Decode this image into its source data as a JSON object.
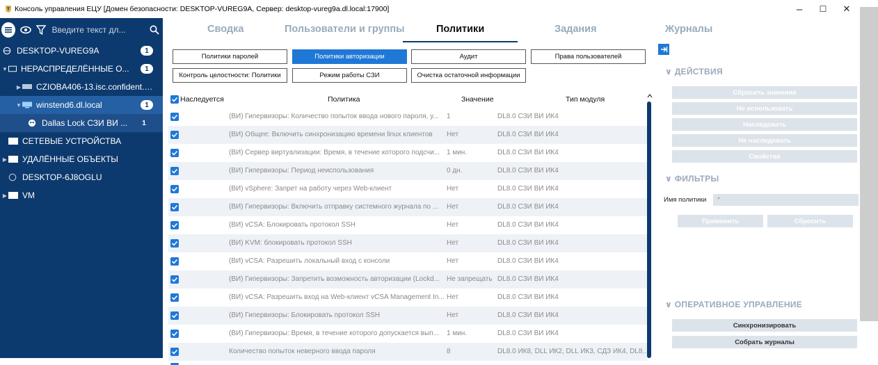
{
  "window": {
    "title": "Консоль управления ЕЦУ [Домен безопасности: DESKTOP-VUREG9A, Сервер: desktop-vureg9a.dl.local:17900]",
    "minimize": "–",
    "maximize": "☐",
    "close": "✕"
  },
  "search": {
    "placeholder": "Введите текст дл..."
  },
  "tree": [
    {
      "label": "DESKTOP-VUREG9A",
      "badge": "1"
    },
    {
      "label": "НЕРАСПРЕДЕЛЁННЫЕ О...",
      "badge": "1"
    },
    {
      "label": "CZIOBA406-13.isc.confident.s..."
    },
    {
      "label": "winstend6.dl.local",
      "badge": "1"
    },
    {
      "label": "Dallas Lock СЗИ ВИ ...",
      "badge": "1"
    },
    {
      "label": "СЕТЕВЫЕ УСТРОЙСТВА"
    },
    {
      "label": "УДАЛЁННЫЕ ОБЪЕКТЫ"
    },
    {
      "label": "DESKTOP-6J8OGLU"
    },
    {
      "label": "VM"
    }
  ],
  "tabs": [
    "Сводка",
    "Пользователи и группы",
    "Политики",
    "Задания",
    "Журналы"
  ],
  "policy_buttons": [
    "Политики паролей",
    "Политики авторизации",
    "Аудит",
    "Права пользователей",
    "Контроль целостности: Политики",
    "Режим работы СЗИ",
    "Очистка остаточной информации"
  ],
  "table": {
    "headers": {
      "inherited": "Наследуется",
      "policy": "Политика",
      "value": "Значение",
      "module": "Тип модуля"
    },
    "rows": [
      {
        "policy": "(ВИ) Гипервизоры: Количество попыток ввода нового пароля, у...",
        "value": "1",
        "module": "DL8.0 СЗИ ВИ ИК4"
      },
      {
        "policy": "(ВИ) Общее: Включить синхронизацию времени linux клиентов",
        "value": "Нет",
        "module": "DL8.0 СЗИ ВИ ИК4"
      },
      {
        "policy": "(ВИ) Сервер виртуализации: Время, в течение которого подсчи...",
        "value": "1 мин.",
        "module": "DL8.0 СЗИ ВИ ИК4"
      },
      {
        "policy": "(ВИ) Гипервизоры: Период неиспользования",
        "value": "0 дн.",
        "module": "DL8.0 СЗИ ВИ ИК4"
      },
      {
        "policy": "(ВИ) vSphere: Запрет на работу через Web-клиент",
        "value": "Нет",
        "module": "DL8.0 СЗИ ВИ ИК4"
      },
      {
        "policy": "(ВИ) Гипервизоры: Включить отправку системного журнала по ...",
        "value": "Нет",
        "module": "DL8.0 СЗИ ВИ ИК4"
      },
      {
        "policy": "(ВИ) vCSA: Блокировать протокол SSH",
        "value": "Нет",
        "module": "DL8.0 СЗИ ВИ ИК4"
      },
      {
        "policy": "(ВИ) KVM: блокировать протокол SSH",
        "value": "Нет",
        "module": "DL8.0 СЗИ ВИ ИК4"
      },
      {
        "policy": "(ВИ) vCSA: Разрешить локальный вход с консоли",
        "value": "Нет",
        "module": "DL8.0 СЗИ ВИ ИК4"
      },
      {
        "policy": "(ВИ) Гипервизоры: Запретить возможность авторизации (Lockd...",
        "value": "Не запрещать",
        "module": "DL8.0 СЗИ ВИ ИК4"
      },
      {
        "policy": "(ВИ) vCSA: Разрешить вход на Web-клиент vCSA Management In...",
        "value": "Нет",
        "module": "DL8.0 СЗИ ВИ ИК4"
      },
      {
        "policy": "(ВИ) Гипервизоры: Блокировать протокол SSH",
        "value": "Нет",
        "module": "DL8.0 СЗИ ВИ ИК4"
      },
      {
        "policy": "(ВИ) Гипервизоры: Время, в течение которого допускается вып...",
        "value": "1 мин.",
        "module": "DL8.0 СЗИ ВИ ИК4"
      },
      {
        "policy": "Количество попыток неверного ввода пароля",
        "value": "8",
        "module": "DL8.0 ИК8, DLL ИК2, DLL ИК3, СДЗ ИК4, DL8..."
      }
    ]
  },
  "actions": {
    "title": "ДЕЙСТВИЯ",
    "buttons": [
      "Сбросить значение",
      "Не использовать",
      "Наследовать",
      "Не наследовать",
      "Свойства"
    ]
  },
  "filters": {
    "title": "ФИЛЬТРЫ",
    "name_label": "Имя политики",
    "name_value": "*",
    "apply": "Применить",
    "reset": "Сбросить"
  },
  "operational": {
    "title": "ОПЕРАТИВНОЕ УПРАВЛЕНИЕ",
    "buttons": [
      "Синхронизировать",
      "Собрать журналы"
    ]
  },
  "colors": {
    "sidebar": "#0d3a6e",
    "accent": "#1f78d6",
    "selected_row": "#2460a3"
  }
}
